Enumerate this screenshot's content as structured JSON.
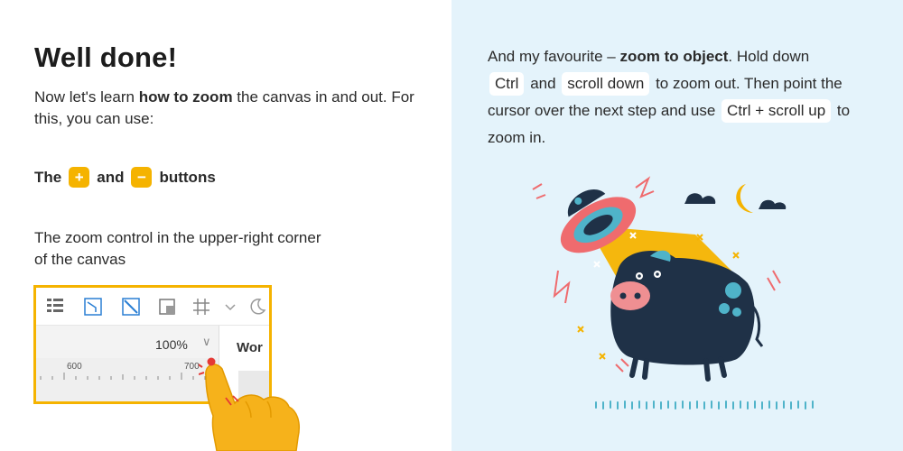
{
  "left": {
    "title": "Well done!",
    "intro_pre": "Now let's learn ",
    "intro_bold": "how to zoom",
    "intro_post": " the canvas in and out. For this, you can use:",
    "buttons_the": "The",
    "buttons_plus": "+",
    "buttons_and": "and",
    "buttons_minus": "−",
    "buttons_label": "buttons",
    "zoom_control_text": "The zoom control in the upper-right corner of the canvas"
  },
  "mock_editor": {
    "zoom_value": "100%",
    "zoom_chevron": "∨",
    "ruler_labels": [
      "600",
      "700"
    ],
    "tab_label": "Wor"
  },
  "right": {
    "p1_pre": "And my favourite – ",
    "p1_bold": "zoom to object",
    "p1_post": ". Hold down",
    "chip_ctrl": "Ctrl",
    "and": "and",
    "chip_scroll_down": "scroll down",
    "p2": "to zoom out. Then point the cursor over the next step and use",
    "chip_ctrl_scroll_up": "Ctrl + scroll up",
    "p3": "to zoom in."
  },
  "colors": {
    "accent_yellow": "#f5b300",
    "right_bg": "#e4f3fb",
    "cow_navy": "#1f3147",
    "ufo_pink": "#ef6b6e",
    "ufo_blue": "#4fb3c9"
  },
  "icons": [
    "plus-icon",
    "minus-icon",
    "frames-icon",
    "connector-icon",
    "line-icon",
    "shadow-icon",
    "grid-icon",
    "chevron-down-icon",
    "moon-icon"
  ]
}
